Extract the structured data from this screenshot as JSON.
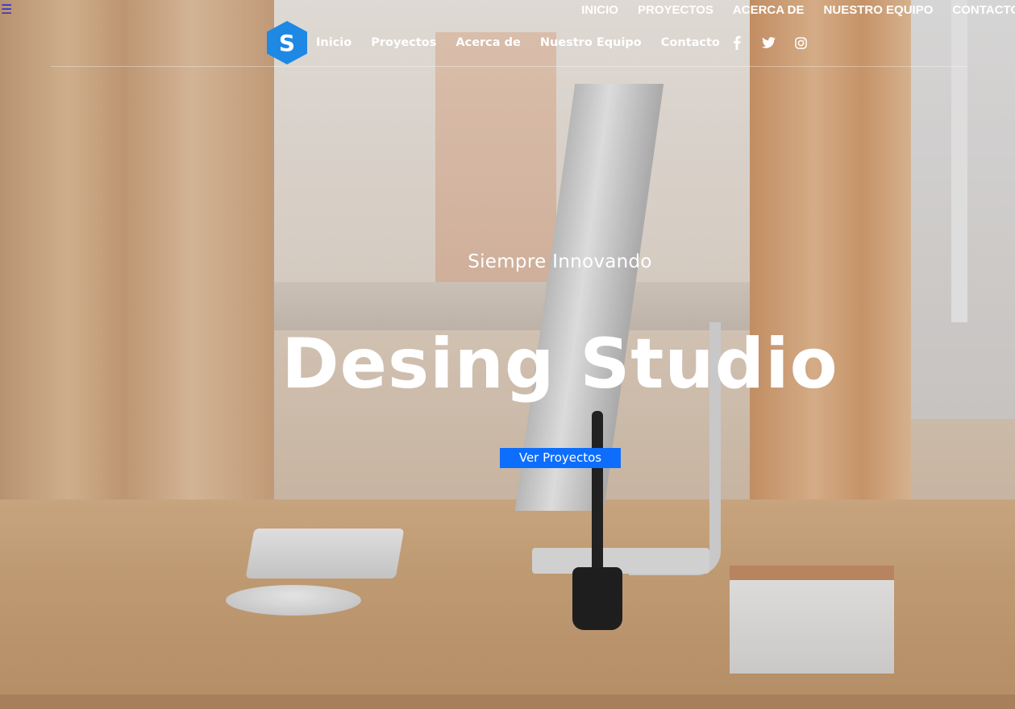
{
  "top_menu": {
    "toggle_icon": "hamburger-icon",
    "items": [
      "INICIO",
      "PROYECTOS",
      "ACERCA DE",
      "NUESTRO EQUIPO",
      "CONTACTO"
    ]
  },
  "navbar": {
    "logo_letter": "S",
    "logo_color": "#1e88e5",
    "links": [
      "Inicio",
      "Proyectos",
      "Acerca de",
      "Nuestro Equipo",
      "Contacto"
    ],
    "socials": [
      "facebook-icon",
      "twitter-icon",
      "instagram-icon"
    ]
  },
  "hero": {
    "tagline": "Siempre Innovando",
    "title": "Desing Studio",
    "cta_label": "Ver Proyectos",
    "cta_color": "#0d6efd"
  }
}
